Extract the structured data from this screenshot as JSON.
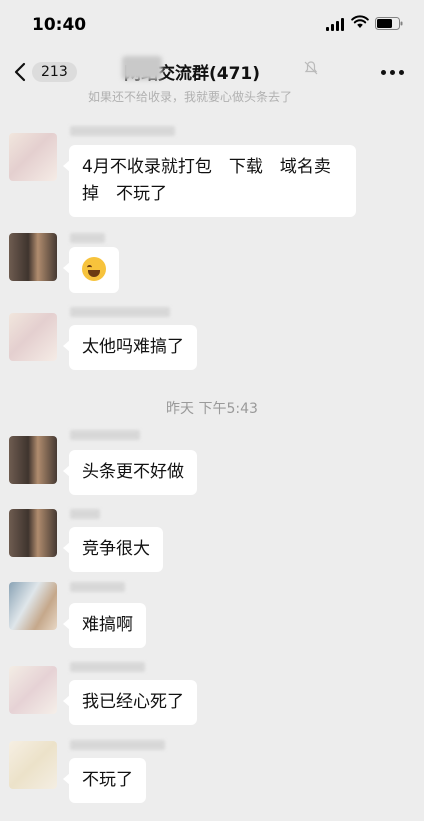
{
  "status_bar": {
    "time": "10:40"
  },
  "nav": {
    "back_count": "213",
    "title": "网站交流群(471)"
  },
  "system_text": "如果还不给收录，我就要心做头条去了",
  "timestamp": "昨天 下午5:43",
  "messages": [
    {
      "text": "4月不收录就打包　下载　域名卖掉　不玩了"
    },
    {
      "text": "",
      "emoji": "laughing-tears"
    },
    {
      "text": "太他吗难搞了"
    },
    {
      "text": "头条更不好做"
    },
    {
      "text": "竞争很大"
    },
    {
      "text": "难搞啊"
    },
    {
      "text": "我已经心死了"
    },
    {
      "text": "不玩了"
    }
  ]
}
